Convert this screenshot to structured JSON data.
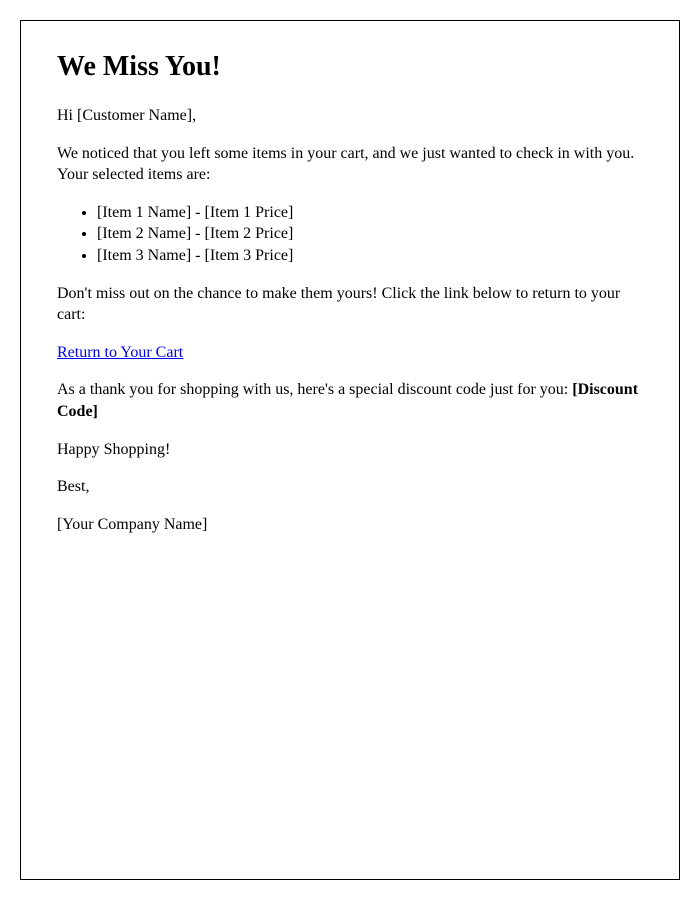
{
  "heading": "We Miss You!",
  "greeting": "Hi [Customer Name],",
  "intro": "We noticed that you left some items in your cart, and we just wanted to check in with you. Your selected items are:",
  "items": [
    "[Item 1 Name] - [Item 1 Price]",
    "[Item 2 Name] - [Item 2 Price]",
    "[Item 3 Name] - [Item 3 Price]"
  ],
  "cta_text": "Don't miss out on the chance to make them yours! Click the link below to return to your cart:",
  "link_text": "Return to Your Cart",
  "discount_prefix": "As a thank you for shopping with us, here's a special discount code just for you: ",
  "discount_code": "[Discount Code]",
  "happy": "Happy Shopping!",
  "signoff": "Best,",
  "company": "[Your Company Name]"
}
